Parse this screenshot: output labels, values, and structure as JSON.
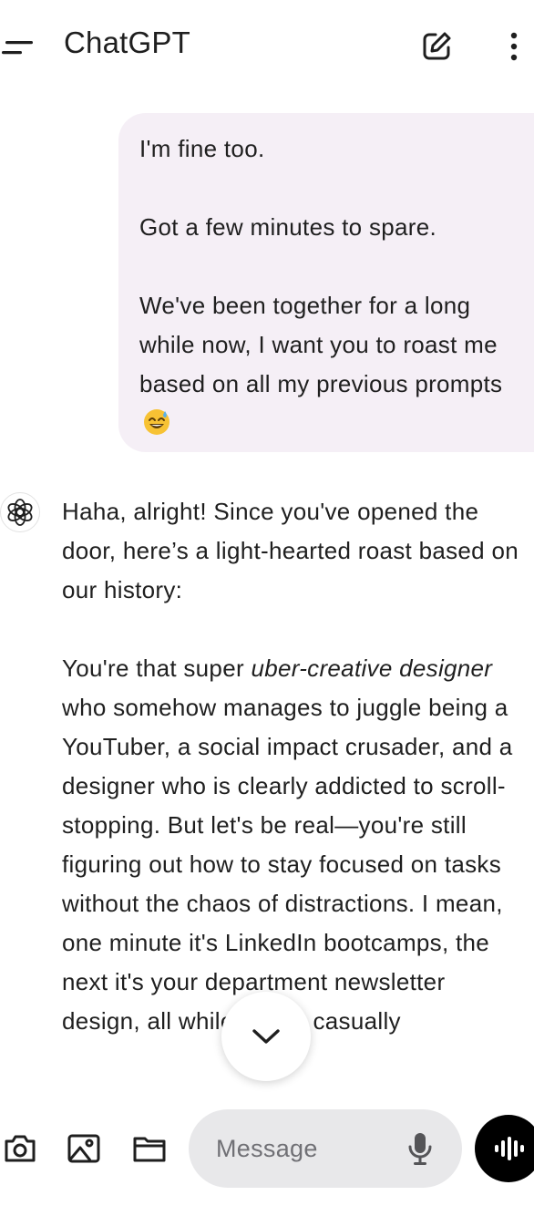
{
  "header": {
    "title": "ChatGPT",
    "menu_icon": "hamburger-menu-icon",
    "new_chat_icon": "edit-icon",
    "more_icon": "more-vertical-icon"
  },
  "chat": {
    "user_message": {
      "paragraphs": [
        "I'm fine too.",
        "Got a few minutes to spare.",
        "We've been together for a long while now, I want you to roast me based on all my previous prompts"
      ],
      "emoji": "😅"
    },
    "assistant_message": {
      "intro": "Haha, alright! Since you've opened the door, here’s a light-hearted roast based on our history:",
      "para2_lead": "You're that super ",
      "para2_italic": "uber-creative designer",
      "para2_rest": " who somehow manages to juggle being a YouTuber, a social impact crusader, and a designer who is clearly addicted to scroll-stopping. But let's be real—you're still figuring out how to stay focused on tasks without the chaos of distractions. I mean, one minute it's LinkedIn bootcamps, the next it's your department newsletter design, all while you're casually"
    }
  },
  "composer": {
    "placeholder": "Message",
    "icons": [
      "camera-icon",
      "image-icon",
      "folder-icon",
      "mic-icon",
      "voice-mode-icon"
    ]
  },
  "colors": {
    "user_bubble": "#f5eff6",
    "composer_bg": "#e8e8ea",
    "voice_button": "#000000",
    "text": "#1f1f1f"
  }
}
